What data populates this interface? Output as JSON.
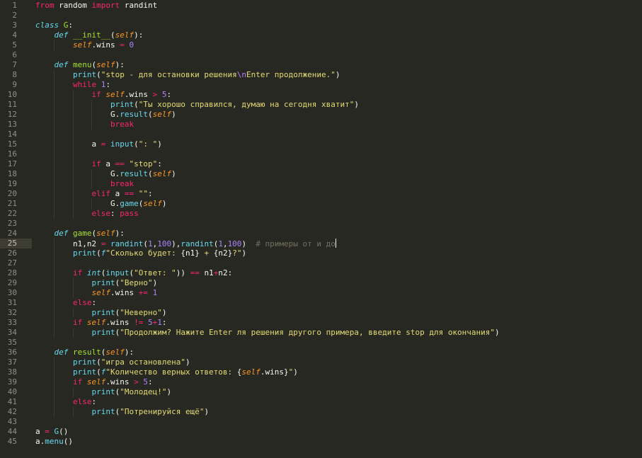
{
  "editor": {
    "theme_colors": {
      "background": "#272822",
      "keyword": "#f92672",
      "function": "#66d9ef",
      "string": "#e6db74",
      "number": "#ae81ff",
      "self": "#fd971f",
      "entity": "#a6e22e",
      "comment": "#75715e"
    },
    "current_line": 25,
    "lines": [
      [
        [
          "k",
          "from"
        ],
        [
          "",
          " random "
        ],
        [
          "k",
          "import"
        ],
        [
          "",
          " randint"
        ]
      ],
      [],
      [
        [
          "s",
          "class"
        ],
        [
          "",
          " "
        ],
        [
          "e",
          "G"
        ],
        [
          "",
          ":"
        ]
      ],
      [
        [
          "",
          "    "
        ],
        [
          "s",
          "def"
        ],
        [
          "",
          " "
        ],
        [
          "e",
          "__init__"
        ],
        [
          "",
          "("
        ],
        [
          "a",
          "self"
        ],
        [
          "",
          "):"
        ]
      ],
      [
        [
          "",
          "        "
        ],
        [
          "a",
          "self"
        ],
        [
          "",
          ".wins "
        ],
        [
          "k",
          "="
        ],
        [
          "",
          " "
        ],
        [
          "n",
          "0"
        ]
      ],
      [],
      [
        [
          "",
          "    "
        ],
        [
          "s",
          "def"
        ],
        [
          "",
          " "
        ],
        [
          "e",
          "menu"
        ],
        [
          "",
          "("
        ],
        [
          "a",
          "self"
        ],
        [
          "",
          "):"
        ]
      ],
      [
        [
          "",
          "        "
        ],
        [
          "f",
          "print"
        ],
        [
          "",
          "("
        ],
        [
          "q",
          "\"stop - для остановки решения"
        ],
        [
          "n",
          "\\n"
        ],
        [
          "q",
          "Enter продолжение.\""
        ],
        [
          "",
          ")"
        ]
      ],
      [
        [
          "",
          "        "
        ],
        [
          "k",
          "while"
        ],
        [
          "",
          " "
        ],
        [
          "n",
          "1"
        ],
        [
          "",
          ":"
        ]
      ],
      [
        [
          "",
          "            "
        ],
        [
          "k",
          "if"
        ],
        [
          "",
          " "
        ],
        [
          "a",
          "self"
        ],
        [
          "",
          ".wins "
        ],
        [
          "k",
          ">"
        ],
        [
          "",
          " "
        ],
        [
          "n",
          "5"
        ],
        [
          "",
          ":"
        ]
      ],
      [
        [
          "",
          "                "
        ],
        [
          "f",
          "print"
        ],
        [
          "",
          "("
        ],
        [
          "q",
          "\"Ты хорошо справился, думаю на сегодня хватит\""
        ],
        [
          "",
          ")"
        ]
      ],
      [
        [
          "",
          "                G."
        ],
        [
          "f",
          "result"
        ],
        [
          "",
          "("
        ],
        [
          "a",
          "self"
        ],
        [
          "",
          ")"
        ]
      ],
      [
        [
          "",
          "                "
        ],
        [
          "k",
          "break"
        ]
      ],
      [],
      [
        [
          "",
          "            a "
        ],
        [
          "k",
          "="
        ],
        [
          "",
          " "
        ],
        [
          "f",
          "input"
        ],
        [
          "",
          "("
        ],
        [
          "q",
          "\": \""
        ],
        [
          "",
          ")"
        ]
      ],
      [],
      [
        [
          "",
          "            "
        ],
        [
          "k",
          "if"
        ],
        [
          "",
          " a "
        ],
        [
          "k",
          "=="
        ],
        [
          "",
          " "
        ],
        [
          "q",
          "\"stop\""
        ],
        [
          "",
          ":"
        ]
      ],
      [
        [
          "",
          "                G."
        ],
        [
          "f",
          "result"
        ],
        [
          "",
          "("
        ],
        [
          "a",
          "self"
        ],
        [
          "",
          ")"
        ]
      ],
      [
        [
          "",
          "                "
        ],
        [
          "k",
          "break"
        ]
      ],
      [
        [
          "",
          "            "
        ],
        [
          "k",
          "elif"
        ],
        [
          "",
          " a "
        ],
        [
          "k",
          "=="
        ],
        [
          "",
          " "
        ],
        [
          "q",
          "\"\""
        ],
        [
          "",
          ":"
        ]
      ],
      [
        [
          "",
          "                G."
        ],
        [
          "f",
          "game"
        ],
        [
          "",
          "("
        ],
        [
          "a",
          "self"
        ],
        [
          "",
          ")"
        ]
      ],
      [
        [
          "",
          "            "
        ],
        [
          "k",
          "else"
        ],
        [
          "",
          ": "
        ],
        [
          "k",
          "pass"
        ]
      ],
      [],
      [
        [
          "",
          "    "
        ],
        [
          "s",
          "def"
        ],
        [
          "",
          " "
        ],
        [
          "e",
          "game"
        ],
        [
          "",
          "("
        ],
        [
          "a",
          "self"
        ],
        [
          "",
          "):"
        ]
      ],
      [
        [
          "",
          "        n1,n2 "
        ],
        [
          "k",
          "="
        ],
        [
          "",
          " "
        ],
        [
          "f",
          "randint"
        ],
        [
          "",
          "("
        ],
        [
          "n",
          "1"
        ],
        [
          "",
          ","
        ],
        [
          "n",
          "100"
        ],
        [
          "",
          "),"
        ],
        [
          "f",
          "randint"
        ],
        [
          "",
          "("
        ],
        [
          "n",
          "1"
        ],
        [
          "",
          ","
        ],
        [
          "n",
          "100"
        ],
        [
          "",
          ")  "
        ],
        [
          "c",
          "# примеры от и до"
        ]
      ],
      [
        [
          "",
          "        "
        ],
        [
          "f",
          "print"
        ],
        [
          "",
          "("
        ],
        [
          "t",
          "f"
        ],
        [
          "q",
          "\"Сколько будет: "
        ],
        [
          "",
          "{n1}"
        ],
        [
          "q",
          " + "
        ],
        [
          "",
          "{n2}"
        ],
        [
          "q",
          "?\""
        ],
        [
          "",
          ")"
        ]
      ],
      [],
      [
        [
          "",
          "        "
        ],
        [
          "k",
          "if"
        ],
        [
          "",
          " "
        ],
        [
          "t",
          "int"
        ],
        [
          "",
          "("
        ],
        [
          "f",
          "input"
        ],
        [
          "",
          "("
        ],
        [
          "q",
          "\"Ответ: \""
        ],
        [
          "",
          ")) "
        ],
        [
          "k",
          "=="
        ],
        [
          "",
          " n1"
        ],
        [
          "k",
          "+"
        ],
        [
          "",
          "n2:"
        ]
      ],
      [
        [
          "",
          "            "
        ],
        [
          "f",
          "print"
        ],
        [
          "",
          "("
        ],
        [
          "q",
          "\"Верно\""
        ],
        [
          "",
          ")"
        ]
      ],
      [
        [
          "",
          "            "
        ],
        [
          "a",
          "self"
        ],
        [
          "",
          ".wins "
        ],
        [
          "k",
          "+="
        ],
        [
          "",
          " "
        ],
        [
          "n",
          "1"
        ]
      ],
      [
        [
          "",
          "        "
        ],
        [
          "k",
          "else"
        ],
        [
          "",
          ":"
        ]
      ],
      [
        [
          "",
          "            "
        ],
        [
          "f",
          "print"
        ],
        [
          "",
          "("
        ],
        [
          "q",
          "\"Неверно\""
        ],
        [
          "",
          ")"
        ]
      ],
      [
        [
          "",
          "        "
        ],
        [
          "k",
          "if"
        ],
        [
          "",
          " "
        ],
        [
          "a",
          "self"
        ],
        [
          "",
          ".wins "
        ],
        [
          "k",
          "!="
        ],
        [
          "",
          " "
        ],
        [
          "n",
          "5"
        ],
        [
          "k",
          "+"
        ],
        [
          "n",
          "1"
        ],
        [
          "",
          ":"
        ]
      ],
      [
        [
          "",
          "            "
        ],
        [
          "f",
          "print"
        ],
        [
          "",
          "("
        ],
        [
          "q",
          "\"Продолжим? Нажите Enter ля решения другого примера, введите stop для окончания\""
        ],
        [
          "",
          ")"
        ]
      ],
      [],
      [
        [
          "",
          "    "
        ],
        [
          "s",
          "def"
        ],
        [
          "",
          " "
        ],
        [
          "e",
          "result"
        ],
        [
          "",
          "("
        ],
        [
          "a",
          "self"
        ],
        [
          "",
          "):"
        ]
      ],
      [
        [
          "",
          "        "
        ],
        [
          "f",
          "print"
        ],
        [
          "",
          "("
        ],
        [
          "q",
          "\"игра остановлена\""
        ],
        [
          "",
          ")"
        ]
      ],
      [
        [
          "",
          "        "
        ],
        [
          "f",
          "print"
        ],
        [
          "",
          "("
        ],
        [
          "t",
          "f"
        ],
        [
          "q",
          "\"Количество верных ответов: "
        ],
        [
          "",
          "{"
        ],
        [
          "a",
          "self"
        ],
        [
          "",
          ".wins}"
        ],
        [
          "q",
          "\""
        ],
        [
          "",
          ")"
        ]
      ],
      [
        [
          "",
          "        "
        ],
        [
          "k",
          "if"
        ],
        [
          "",
          " "
        ],
        [
          "a",
          "self"
        ],
        [
          "",
          ".wins "
        ],
        [
          "k",
          ">"
        ],
        [
          "",
          " "
        ],
        [
          "n",
          "5"
        ],
        [
          "",
          ":"
        ]
      ],
      [
        [
          "",
          "            "
        ],
        [
          "f",
          "print"
        ],
        [
          "",
          "("
        ],
        [
          "q",
          "\"Молодец!\""
        ],
        [
          "",
          ")"
        ]
      ],
      [
        [
          "",
          "        "
        ],
        [
          "k",
          "else"
        ],
        [
          "",
          ":"
        ]
      ],
      [
        [
          "",
          "            "
        ],
        [
          "f",
          "print"
        ],
        [
          "",
          "("
        ],
        [
          "q",
          "\"Потренируйся ещё\""
        ],
        [
          "",
          ")"
        ]
      ],
      [],
      [
        [
          "",
          "a "
        ],
        [
          "k",
          "="
        ],
        [
          "",
          " "
        ],
        [
          "f",
          "G"
        ],
        [
          "",
          "()"
        ]
      ],
      [
        [
          "",
          "a."
        ],
        [
          "f",
          "menu"
        ],
        [
          "",
          "()"
        ]
      ]
    ]
  }
}
